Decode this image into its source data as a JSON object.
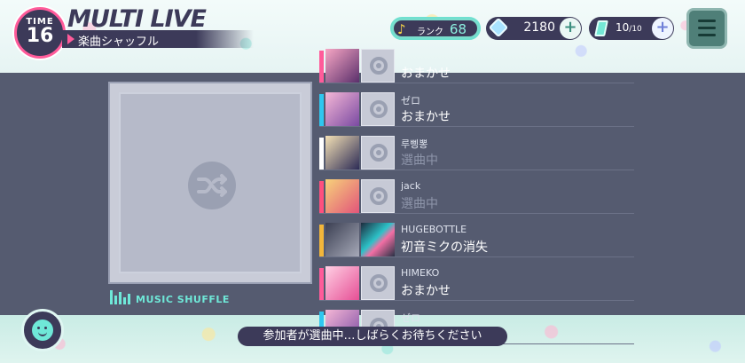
{
  "header": {
    "time_label": "TIME",
    "time_value": "16",
    "title": "MULTI LIVE",
    "subtitle": "楽曲シャッフル"
  },
  "status": {
    "rank_label": "ランク",
    "rank_value": "68",
    "gems": "2180",
    "boost_value": "10",
    "boost_max": "/10"
  },
  "menu": {
    "icon": "hamburger-icon"
  },
  "shuffle": {
    "label": "MUSIC SHUFFLE",
    "icon": "shuffle-icon"
  },
  "participants": [
    {
      "name": "",
      "status": "おまかせ",
      "dim": false,
      "accent": "#ff5b9a"
    },
    {
      "name": "ゼロ",
      "status": "おまかせ",
      "dim": false,
      "accent": "#2ec7f0"
    },
    {
      "name": "루삥뽕",
      "status": "選曲中",
      "dim": true,
      "accent": "#ffffff"
    },
    {
      "name": "jack",
      "status": "選曲中",
      "dim": true,
      "accent": "#ff4f7e"
    },
    {
      "name": "HUGEBOTTLE",
      "status": "初音ミクの消失",
      "dim": false,
      "accent": "#f2b63a"
    },
    {
      "name": "HIMEKO",
      "status": "おまかせ",
      "dim": false,
      "accent": "#ff5b9a"
    },
    {
      "name": "ゼロ",
      "status": "",
      "dim": false,
      "accent": "#2ec7f0"
    }
  ],
  "bottom": {
    "message": "参加者が選曲中…しばらくお待ちください",
    "chat_icon": "smiley-icon"
  },
  "colors": {
    "navy": "#3c3a59",
    "mint": "#6fe8d8",
    "pink": "#ff5b9a",
    "panel": "#555b70"
  }
}
